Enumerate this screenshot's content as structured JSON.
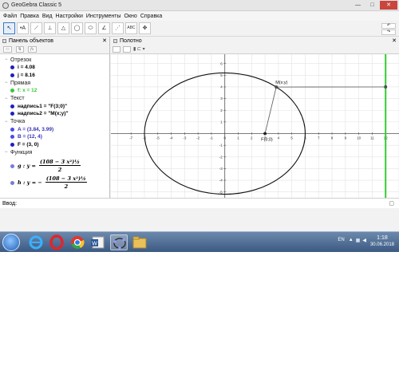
{
  "window": {
    "title": "GeoGebra Classic 5",
    "controls": {
      "minimize": "—",
      "maximize": "□",
      "close": "✕"
    }
  },
  "menu": [
    "Файл",
    "Правка",
    "Вид",
    "Настройки",
    "Инструменты",
    "Окно",
    "Справка"
  ],
  "toolbar": {
    "tools": [
      {
        "name": "move-tool",
        "glyph": "↖"
      },
      {
        "name": "point-tool",
        "glyph": "•A"
      },
      {
        "name": "line-tool",
        "glyph": "⟋"
      },
      {
        "name": "perpendicular-tool",
        "glyph": "⊥"
      },
      {
        "name": "polygon-tool",
        "glyph": "△"
      },
      {
        "name": "circle-tool",
        "glyph": "◯"
      },
      {
        "name": "ellipse-tool",
        "glyph": "⬭"
      },
      {
        "name": "angle-tool",
        "glyph": "∠"
      },
      {
        "name": "reflect-tool",
        "glyph": "⋰"
      },
      {
        "name": "text-tool",
        "glyph": "ABC"
      },
      {
        "name": "move-graphics-tool",
        "glyph": "✥"
      }
    ],
    "undo": "↶",
    "redo": "↷"
  },
  "algebra": {
    "title": "Панель объектов",
    "close": "✕",
    "categories": [
      {
        "label": "Отрезок",
        "items": [
          {
            "text": "i = 4.08",
            "color": "#1f1fbf"
          },
          {
            "text": "j = 8.16",
            "color": "#1f1fbf"
          }
        ]
      },
      {
        "label": "Прямая",
        "items": [
          {
            "text": "f: x = 12",
            "color": "#37c837",
            "text_color": "#37c837"
          }
        ]
      },
      {
        "label": "Текст",
        "items": [
          {
            "text": "надпись1 = \"F(3;0)\"",
            "color": "#1f1fbf"
          },
          {
            "text": "надпись2 = \"M(x;y)\"",
            "color": "#1f1fbf"
          }
        ]
      },
      {
        "label": "Точка",
        "items": [
          {
            "text": "A = (3.84, 3.99)",
            "color": "#4a4ae6",
            "text_color": "#3434b4"
          },
          {
            "text": "B = (12, 4)",
            "color": "#4a4ae6",
            "text_color": "#3434b4"
          },
          {
            "text": "F = (3, 0)",
            "color": "#1f1fbf"
          }
        ]
      },
      {
        "label": "Функция",
        "items": []
      }
    ],
    "functions": [
      {
        "name": "g : y =",
        "numerator": "(108 − 3 x²)½",
        "denominator": "2",
        "color": "#7a7ad6"
      },
      {
        "name": "h : y = −",
        "numerator": "(108 − 3 x²)½",
        "denominator": "2",
        "color": "#7a7ad6"
      }
    ]
  },
  "graphics": {
    "title": "Полотно",
    "close": "✕",
    "labels": {
      "point_m": "M(x;y)",
      "point_f": "F(3;0)"
    }
  },
  "chart_data": {
    "type": "scatter",
    "title": "",
    "xlabel": "",
    "ylabel": "",
    "xlim": [
      -8.5,
      13
    ],
    "ylim": [
      -5.5,
      6.8
    ],
    "grid": true,
    "x_ticks": [
      -7,
      -6,
      -5,
      -4,
      -3,
      -2,
      -1,
      0,
      1,
      2,
      3,
      4,
      5,
      6,
      7,
      8,
      9,
      10,
      11,
      12
    ],
    "y_ticks": [
      -5,
      -4,
      -3,
      -2,
      -1,
      1,
      2,
      3,
      4,
      5,
      6
    ],
    "ellipse": {
      "center": [
        0,
        0
      ],
      "semi_x": 6,
      "semi_y": 5.196
    },
    "vertical_line_x": 12,
    "points": [
      {
        "name": "M",
        "x": 3.84,
        "y": 3.99,
        "label": "M(x;y)"
      },
      {
        "name": "F",
        "x": 3,
        "y": 0,
        "label": "F(3;0)"
      },
      {
        "name": "B",
        "x": 12,
        "y": 4,
        "label": ""
      }
    ],
    "segments": [
      {
        "from": [
          3.84,
          3.99
        ],
        "to": [
          3,
          0
        ]
      },
      {
        "from": [
          3.84,
          3.99
        ],
        "to": [
          12,
          4
        ]
      }
    ],
    "colors": {
      "grid": "#e3e3e3",
      "axes": "#555555",
      "ellipse": "#111111",
      "line": "#33cc33",
      "segment": "#555555"
    }
  },
  "inputbar": {
    "label": "Ввод:",
    "value": "",
    "right_icon": "▢"
  },
  "taskbar": {
    "apps": [
      "ie-app",
      "opera-app",
      "chrome-app",
      "word-app",
      "geogebra-app",
      "explorer-app"
    ],
    "language": "EN",
    "time": "1:18",
    "date": "30.06.2018"
  }
}
